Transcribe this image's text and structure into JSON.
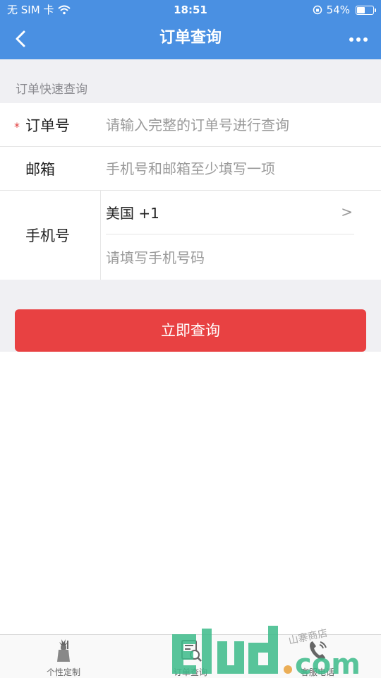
{
  "status_bar": {
    "carrier": "无 SIM 卡",
    "time": "18:51",
    "battery_percent": "54%",
    "battery_level": 0.54
  },
  "nav": {
    "title": "订单查询",
    "back_icon": "chevron-left-icon",
    "more_icon": "more-dots-icon"
  },
  "section_label": "订单快速查询",
  "form": {
    "order": {
      "label": "订单号",
      "required_mark": "*",
      "placeholder": "请输入完整的订单号进行查询",
      "value": ""
    },
    "email": {
      "label": "邮箱",
      "placeholder": "手机号和邮箱至少填写一项",
      "value": ""
    },
    "phone": {
      "label": "手机号",
      "country": "美国 +1",
      "country_chevron": ">",
      "placeholder": "请填写手机号码",
      "value": ""
    }
  },
  "submit_label": "立即查询",
  "tabs": [
    {
      "label": "个性定制",
      "icon": "statue-icon"
    },
    {
      "label": "订单查询",
      "icon": "order-search-icon"
    },
    {
      "label": "客服电话",
      "icon": "phone-icon"
    }
  ],
  "colors": {
    "header": "#4a90e2",
    "submit": "#e84142",
    "required": "#e03c3c"
  }
}
